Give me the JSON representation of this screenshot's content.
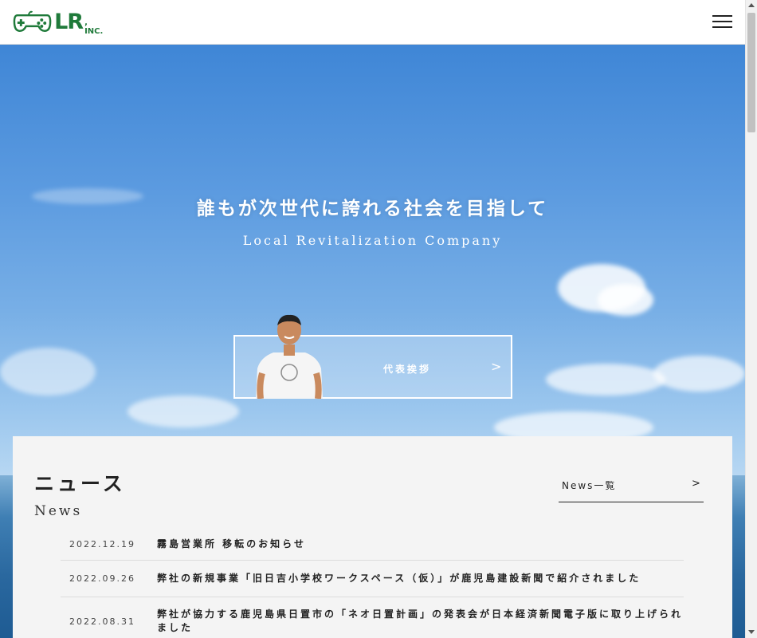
{
  "header": {
    "logo_text": "LR",
    "logo_suffix": ", INC.",
    "brand_color": "#1f7a3a"
  },
  "hero": {
    "title": "誰もが次世代に誇れる社会を目指して",
    "subtitle": "Local Revitalization Company",
    "ceo_button": {
      "label": "代表挨拶",
      "arrow": ">"
    }
  },
  "news": {
    "title": "ニュース",
    "subtitle": "News",
    "all_link": {
      "label": "News一覧",
      "arrow": ">"
    },
    "items": [
      {
        "date": "2022.12.19",
        "text": "霧島営業所 移転のお知らせ"
      },
      {
        "date": "2022.09.26",
        "text": "弊社の新規事業「旧日吉小学校ワークスペース（仮）」が鹿児島建設新聞で紹介されました"
      },
      {
        "date": "2022.08.31",
        "text": "弊社が協力する鹿児島県日置市の「ネオ日置計画」の発表会が日本経済新聞電子版に取り上げられました"
      }
    ]
  }
}
